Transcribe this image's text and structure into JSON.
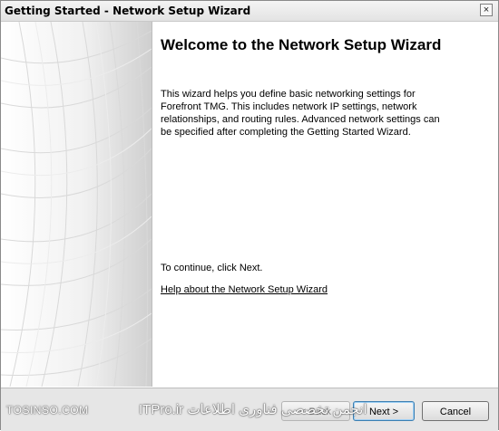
{
  "window": {
    "title": "Getting Started - Network Setup Wizard",
    "close_glyph": "×"
  },
  "main": {
    "heading": "Welcome to the Network Setup Wizard",
    "intro": "This wizard helps you define basic networking settings for Forefront TMG. This includes network IP settings, network relationships, and routing rules. Advanced network settings can be specified after completing the Getting Started Wizard.",
    "continue_text": "To continue, click Next.",
    "help_link": "Help about the Network Setup Wizard"
  },
  "footer": {
    "back_label": "< Back",
    "next_label": "Next >",
    "cancel_label": "Cancel",
    "watermark_en": "TOSINSO.COM",
    "watermark_fa": "انجمن تخصصی فناوری اطلاعات ITPro.ir"
  },
  "icons": {
    "close": "close-icon"
  }
}
